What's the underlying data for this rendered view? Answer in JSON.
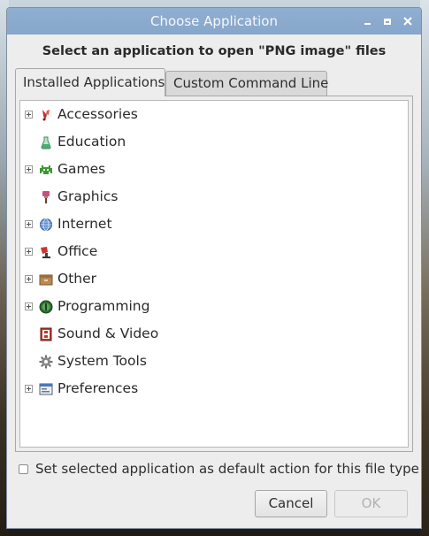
{
  "window": {
    "title": "Choose Application",
    "controls": [
      "minimize-icon",
      "maximize-icon",
      "close-icon"
    ]
  },
  "prompt": "Select an application to open \"PNG image\" files",
  "tabs": [
    {
      "label": "Installed Applications",
      "active": true
    },
    {
      "label": "Custom Command Line",
      "active": false
    }
  ],
  "categories": [
    {
      "label": "Accessories",
      "icon": "accessories-icon",
      "expandable": true
    },
    {
      "label": "Education",
      "icon": "education-icon",
      "expandable": false
    },
    {
      "label": "Games",
      "icon": "games-icon",
      "expandable": true
    },
    {
      "label": "Graphics",
      "icon": "graphics-icon",
      "expandable": false
    },
    {
      "label": "Internet",
      "icon": "internet-icon",
      "expandable": true
    },
    {
      "label": "Office",
      "icon": "office-icon",
      "expandable": true
    },
    {
      "label": "Other",
      "icon": "other-icon",
      "expandable": true
    },
    {
      "label": "Programming",
      "icon": "programming-icon",
      "expandable": true
    },
    {
      "label": "Sound & Video",
      "icon": "sound-video-icon",
      "expandable": false
    },
    {
      "label": "System Tools",
      "icon": "system-tools-icon",
      "expandable": false
    },
    {
      "label": "Preferences",
      "icon": "preferences-icon",
      "expandable": true
    }
  ],
  "default_checkbox": {
    "label": "Set selected application as default action for this file type",
    "checked": false
  },
  "buttons": {
    "cancel": "Cancel",
    "ok": "OK"
  },
  "colors": {
    "titlebar": "#88a8cc",
    "window_bg": "#ededed",
    "disabled_text": "#b2b2b2"
  }
}
